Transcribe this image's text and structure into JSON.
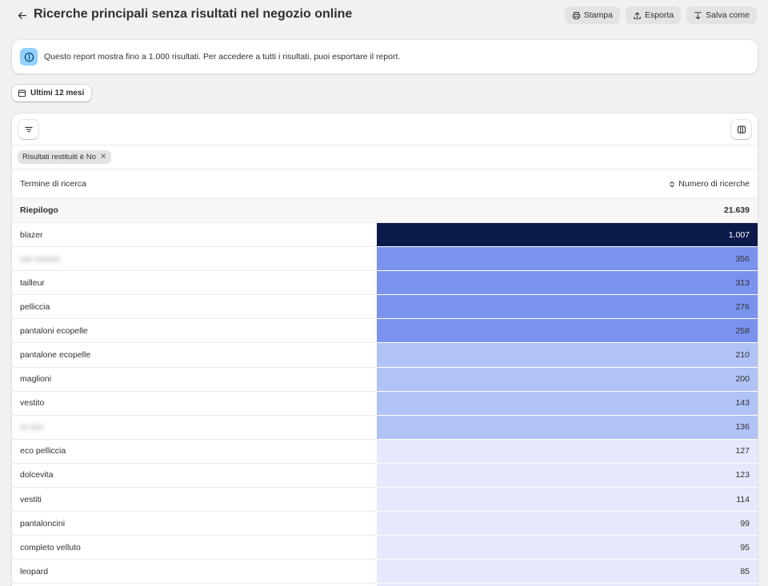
{
  "header": {
    "title": "Ricerche principali senza risultati nel negozio online",
    "buttons": {
      "print": "Stampa",
      "export": "Esporta",
      "save": "Salva come"
    }
  },
  "banner": {
    "text": "Questo report mostra fino a 1.000 risultati. Per accedere a tutti i risultati, puoi esportare il report."
  },
  "date_filter": {
    "label": "Ultimi 12 mesi"
  },
  "filter_chip": {
    "label": "Risultati restituiti è No"
  },
  "table": {
    "columns": [
      "Termine di ricerca",
      "Numero di ricerche"
    ],
    "summary": {
      "label": "Riepilogo",
      "value": "21.639"
    },
    "rows": [
      {
        "term": "blazer",
        "count": "1.007",
        "bg": "#0c1a4b",
        "fg": "#ffffff",
        "blurred": false
      },
      {
        "term": "xxx xxxxxx",
        "count": "356",
        "bg": "#7a93ef",
        "fg": "#303030",
        "blurred": true
      },
      {
        "term": "tailleur",
        "count": "313",
        "bg": "#7a93ef",
        "fg": "#303030",
        "blurred": false
      },
      {
        "term": "pelliccia",
        "count": "276",
        "bg": "#7a93ef",
        "fg": "#303030",
        "blurred": false
      },
      {
        "term": "pantaloni ecopelle",
        "count": "258",
        "bg": "#7a93ef",
        "fg": "#303030",
        "blurred": false
      },
      {
        "term": "pantalone ecopelle",
        "count": "210",
        "bg": "#b1c2f6",
        "fg": "#303030",
        "blurred": false
      },
      {
        "term": "maglioni",
        "count": "200",
        "bg": "#b1c2f6",
        "fg": "#303030",
        "blurred": false
      },
      {
        "term": "vestito",
        "count": "143",
        "bg": "#b1c2f6",
        "fg": "#303030",
        "blurred": false
      },
      {
        "term": "xx xxx",
        "count": "136",
        "bg": "#b1c2f6",
        "fg": "#303030",
        "blurred": true
      },
      {
        "term": "eco pelliccia",
        "count": "127",
        "bg": "#e5e9fb",
        "fg": "#303030",
        "blurred": false
      },
      {
        "term": "dolcevita",
        "count": "123",
        "bg": "#e5e9fb",
        "fg": "#303030",
        "blurred": false
      },
      {
        "term": "vestiti",
        "count": "114",
        "bg": "#e5e9fb",
        "fg": "#303030",
        "blurred": false
      },
      {
        "term": "pantaloncini",
        "count": "99",
        "bg": "#e5e9fb",
        "fg": "#303030",
        "blurred": false
      },
      {
        "term": "completo velluto",
        "count": "95",
        "bg": "#e5e9fb",
        "fg": "#303030",
        "blurred": false
      },
      {
        "term": "leopard",
        "count": "85",
        "bg": "#e5e9fb",
        "fg": "#303030",
        "blurred": false
      },
      {
        "term": "",
        "count": "",
        "bg": "#e5e9fb",
        "fg": "#303030",
        "blurred": false
      }
    ]
  },
  "icons": {
    "back": "arrow-left-icon",
    "print": "printer-icon",
    "export": "upload-icon",
    "save": "download-icon",
    "info": "info-icon",
    "calendar": "calendar-icon",
    "filter": "filter-lines-icon",
    "columns": "columns-icon",
    "sort": "sort-arrows-icon",
    "remove": "close-icon"
  }
}
